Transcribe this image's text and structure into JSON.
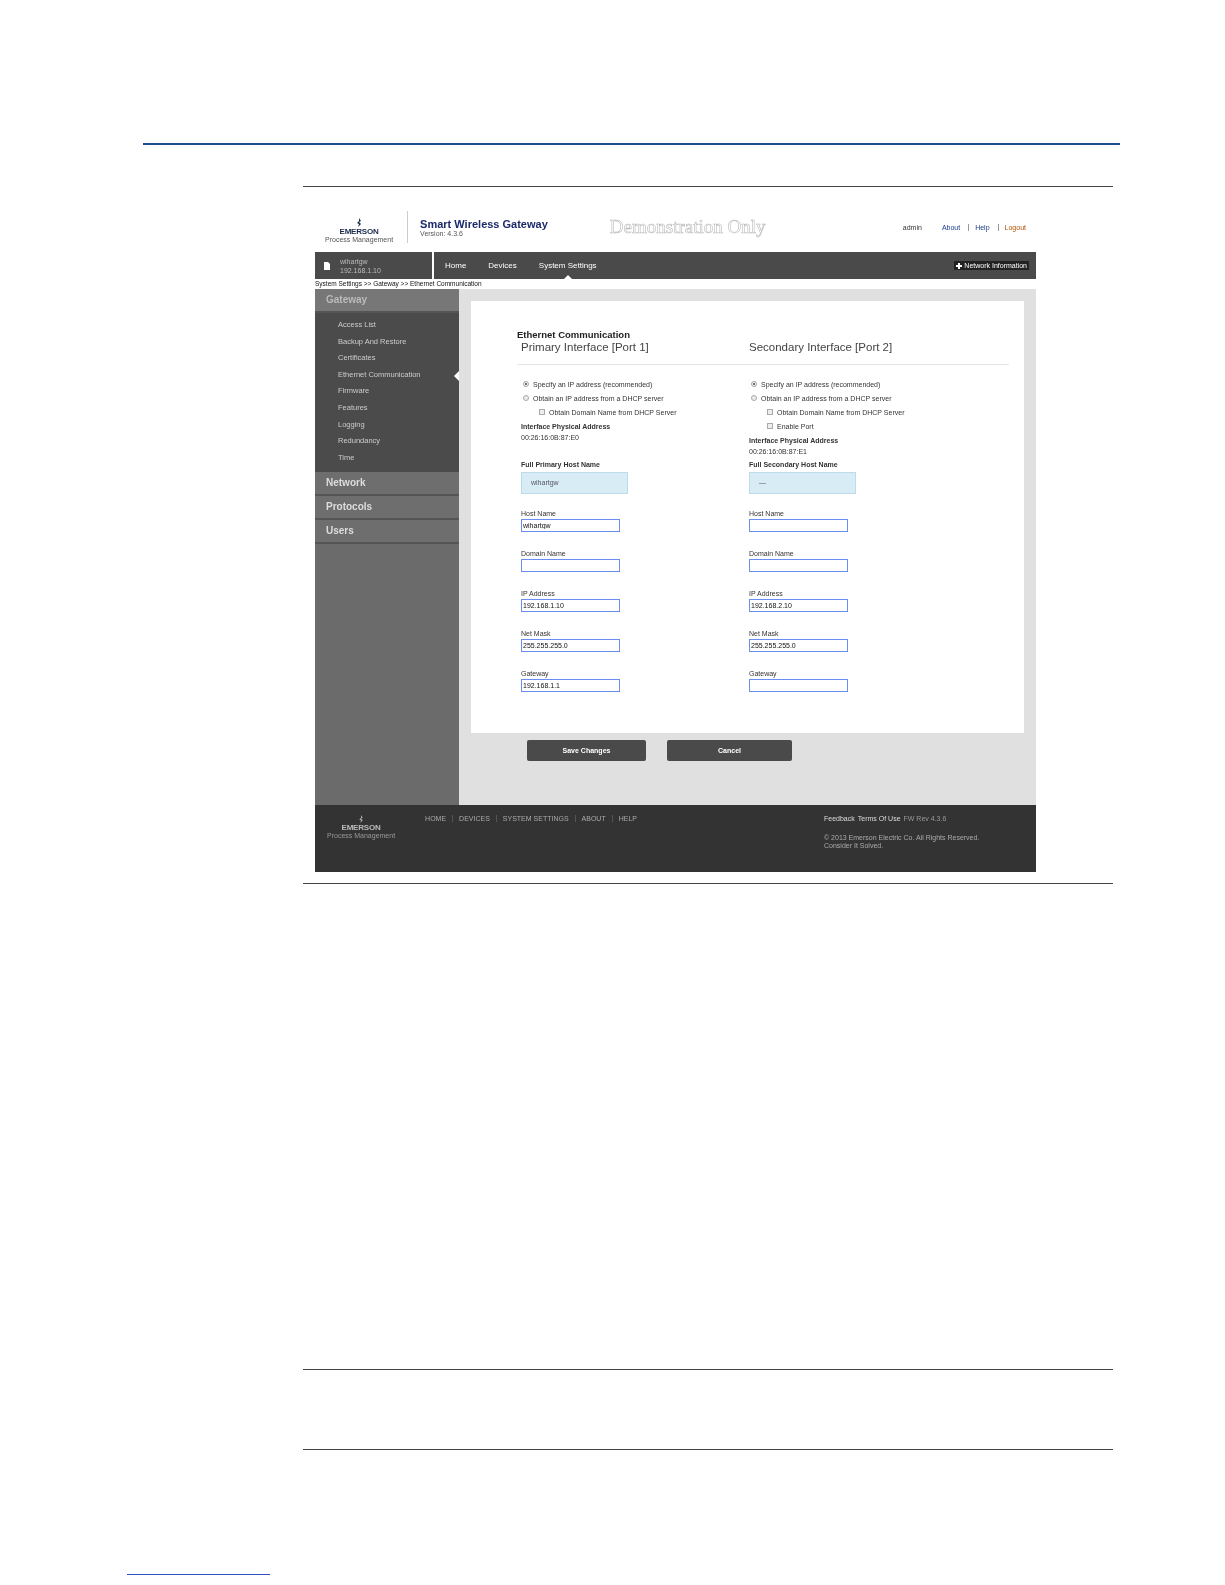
{
  "header": {
    "logo": "EMERSON",
    "logo_sub": "Process Management",
    "product": "Smart Wireless Gateway",
    "version": "Version: 4.3.6",
    "stamp": "Demonstration Only",
    "user": "admin",
    "links": [
      "About",
      "Help",
      "Logout"
    ]
  },
  "nav": {
    "device_name": "wihartgw",
    "device_ip": "192.168.1.10",
    "tabs": [
      {
        "label": "Home",
        "selected": false
      },
      {
        "label": "Devices",
        "selected": false
      },
      {
        "label": "System Settings",
        "selected": true
      }
    ],
    "network_info": "Network Information"
  },
  "breadcrumb": "System Settings >> Gateway >> Ethernet Communication",
  "sidebar": {
    "sections": [
      {
        "label": "Gateway",
        "expanded": true,
        "children": [
          {
            "label": "Access List",
            "selected": false
          },
          {
            "label": "Backup And Restore",
            "selected": false
          },
          {
            "label": "Certificates",
            "selected": false
          },
          {
            "label": "Ethernet Communication",
            "selected": true
          },
          {
            "label": "Firmware",
            "selected": false
          },
          {
            "label": "Features",
            "selected": false
          },
          {
            "label": "Logging",
            "selected": false
          },
          {
            "label": "Redundancy",
            "selected": false
          },
          {
            "label": "Time",
            "selected": false
          }
        ]
      },
      {
        "label": "Network",
        "expanded": false
      },
      {
        "label": "Protocols",
        "expanded": false
      },
      {
        "label": "Users",
        "expanded": false
      }
    ]
  },
  "form": {
    "title": "Ethernet Communication",
    "interfaces": [
      {
        "heading": "Primary Interface [Port 1]",
        "options": [
          {
            "label": "Specify an IP address (recommended)",
            "selected": true
          },
          {
            "label": "Obtain an IP address from a DHCP server",
            "selected": false
          }
        ],
        "checkboxes": [
          {
            "label": "Obtain Domain Name from DHCP Server",
            "checked": false
          }
        ],
        "mac_label": "Interface Physical Address",
        "mac": "00:26:16:0B:87:E0",
        "full_host_label": "Full Primary Host Name",
        "full_host": "wihartgw",
        "fields": [
          {
            "label": "Host Name",
            "value": "wihartgw"
          },
          {
            "label": "Domain Name"
          },
          {
            "label": "IP Address",
            "value": "192.168.1.10"
          },
          {
            "label": "Net Mask",
            "value": "255.255.255.0"
          },
          {
            "label": "Gateway",
            "value": "192.168.1.1"
          }
        ]
      },
      {
        "heading": "Secondary Interface [Port 2]",
        "options": [
          {
            "label": "Specify an IP address (recommended)",
            "selected": true
          },
          {
            "label": "Obtain an IP address from a DHCP server",
            "selected": false
          }
        ],
        "checkboxes": [
          {
            "label": "Obtain Domain Name from DHCP Server",
            "checked": false
          },
          {
            "label": "Enable Port",
            "checked": false
          }
        ],
        "mac_label": "Interface Physical Address",
        "mac": "00:26:16:0B:87:E1",
        "full_host_label": "Full Secondary Host Name",
        "full_host": "—",
        "fields": [
          {
            "label": "Host Name"
          },
          {
            "label": "Domain Name"
          },
          {
            "label": "IP Address",
            "value": "192.168.2.10"
          },
          {
            "label": "Net Mask",
            "value": "255.255.255.0"
          },
          {
            "label": "Gateway"
          }
        ]
      }
    ]
  },
  "buttons": [
    "Save Changes",
    "Cancel"
  ],
  "footer": {
    "logo": "EMERSON",
    "logo_sub": "Process Management",
    "links": [
      "HOME",
      "DEVICES",
      "SYSTEM SETTINGS",
      "ABOUT",
      "HELP"
    ],
    "right_links": [
      "Feedback",
      "Terms Of Use"
    ],
    "fw": "FW Rev 4.3.6",
    "copyright": "© 2013 Emerson Electric Co. All Rights Reserved.",
    "tagline": "Consider It Solved."
  }
}
